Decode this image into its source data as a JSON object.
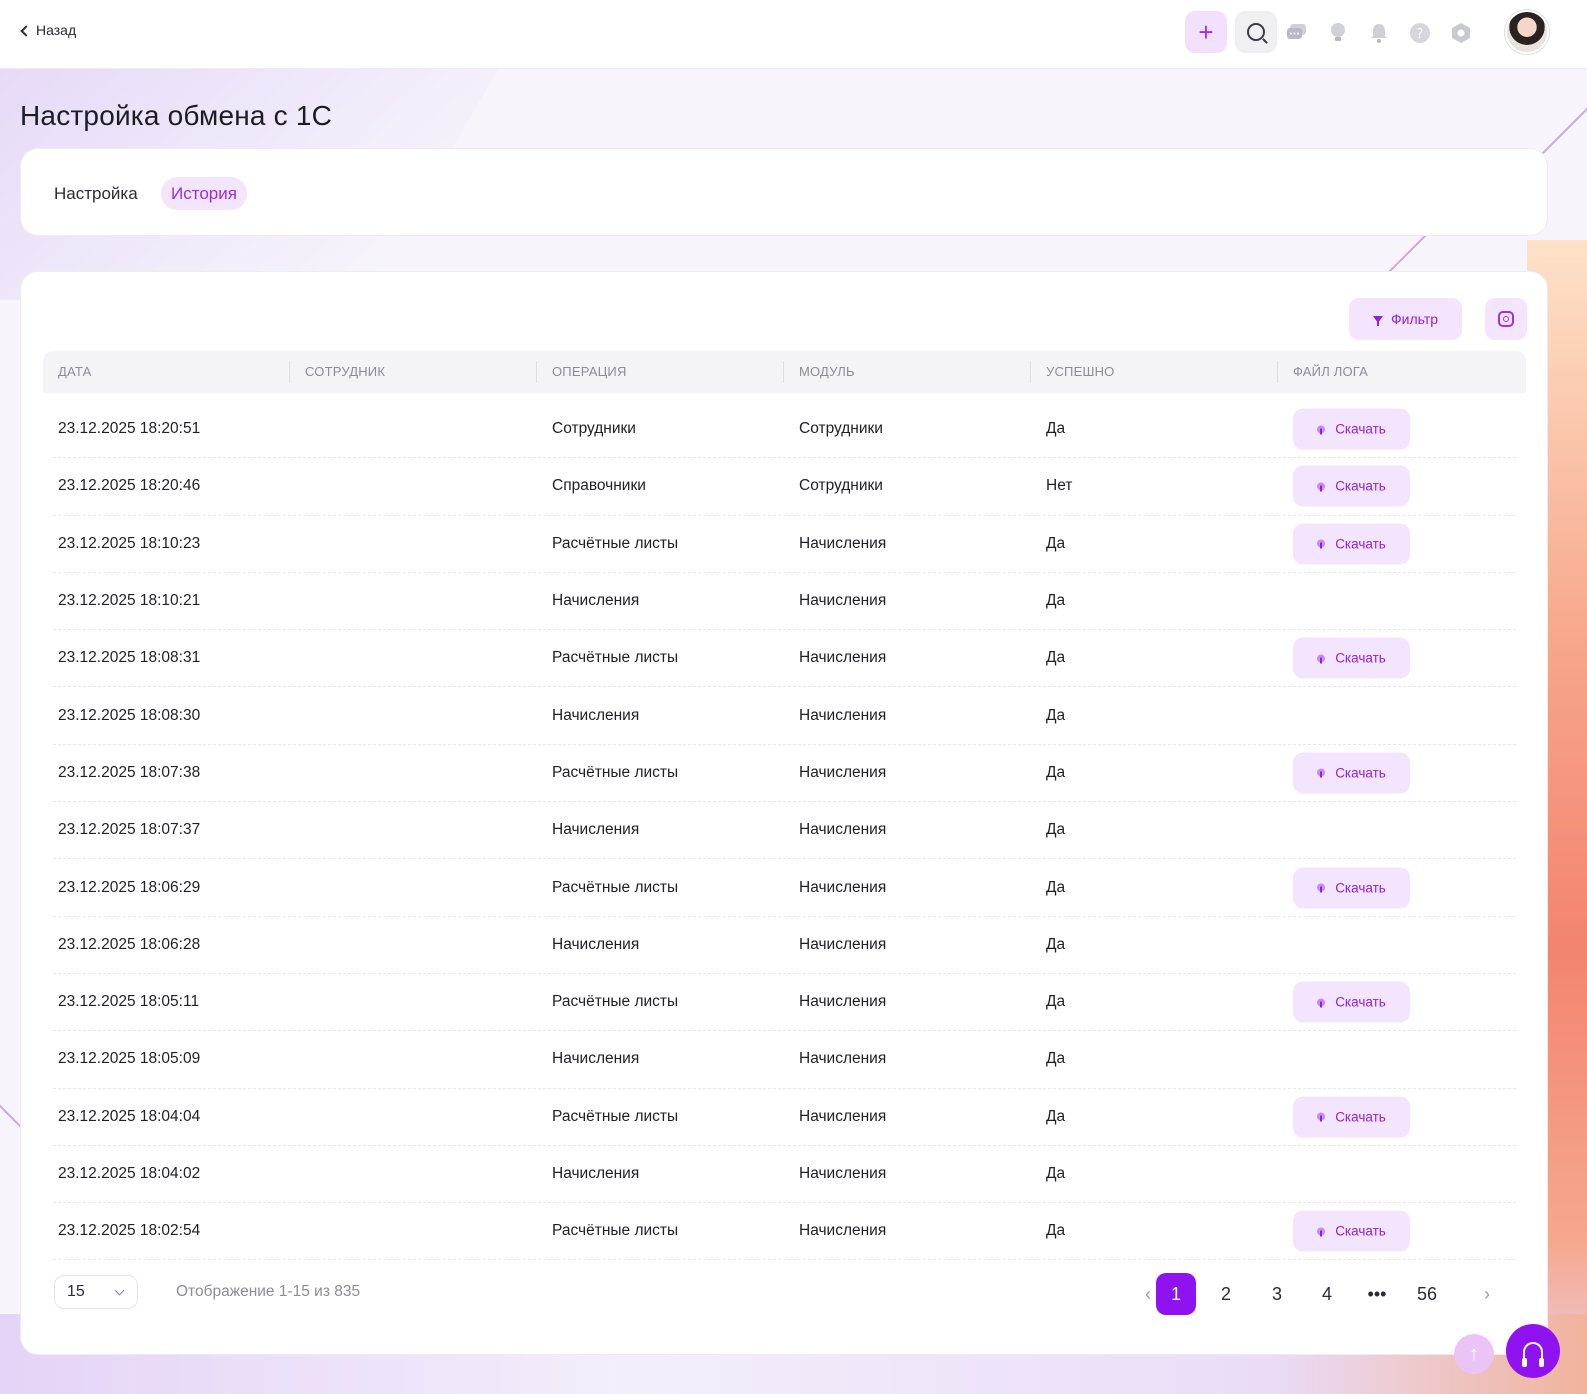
{
  "nav": {
    "back_label": "Назад"
  },
  "header": {
    "icons": [
      "plus-icon",
      "search-icon",
      "chat-icon",
      "lightbulb-icon",
      "bell-icon",
      "help-icon",
      "settings-icon"
    ]
  },
  "page": {
    "title": "Настройка обмена с 1С"
  },
  "tabs": [
    {
      "label": "Настройка",
      "active": false
    },
    {
      "label": "История",
      "active": true
    }
  ],
  "toolbar": {
    "filter_label": "Фильтр"
  },
  "table": {
    "columns": [
      "ДАТА",
      "СОТРУДНИК",
      "ОПЕРАЦИЯ",
      "МОДУЛЬ",
      "УСПЕШНО",
      "ФАЙЛ ЛОГА"
    ],
    "download_label": "Скачать",
    "rows": [
      {
        "date": "23.12.2025 18:20:51",
        "employee": "",
        "operation": "Сотрудники",
        "module": "Сотрудники",
        "success": "Да",
        "has_log": true
      },
      {
        "date": "23.12.2025 18:20:46",
        "employee": "",
        "operation": "Справочники",
        "module": "Сотрудники",
        "success": "Нет",
        "has_log": true
      },
      {
        "date": "23.12.2025 18:10:23",
        "employee": "",
        "operation": "Расчётные листы",
        "module": "Начисления",
        "success": "Да",
        "has_log": true
      },
      {
        "date": "23.12.2025 18:10:21",
        "employee": "",
        "operation": "Начисления",
        "module": "Начисления",
        "success": "Да",
        "has_log": false
      },
      {
        "date": "23.12.2025 18:08:31",
        "employee": "",
        "operation": "Расчётные листы",
        "module": "Начисления",
        "success": "Да",
        "has_log": true
      },
      {
        "date": "23.12.2025 18:08:30",
        "employee": "",
        "operation": "Начисления",
        "module": "Начисления",
        "success": "Да",
        "has_log": false
      },
      {
        "date": "23.12.2025 18:07:38",
        "employee": "",
        "operation": "Расчётные листы",
        "module": "Начисления",
        "success": "Да",
        "has_log": true
      },
      {
        "date": "23.12.2025 18:07:37",
        "employee": "",
        "operation": "Начисления",
        "module": "Начисления",
        "success": "Да",
        "has_log": false
      },
      {
        "date": "23.12.2025 18:06:29",
        "employee": "",
        "operation": "Расчётные листы",
        "module": "Начисления",
        "success": "Да",
        "has_log": true
      },
      {
        "date": "23.12.2025 18:06:28",
        "employee": "",
        "operation": "Начисления",
        "module": "Начисления",
        "success": "Да",
        "has_log": false
      },
      {
        "date": "23.12.2025 18:05:11",
        "employee": "",
        "operation": "Расчётные листы",
        "module": "Начисления",
        "success": "Да",
        "has_log": true
      },
      {
        "date": "23.12.2025 18:05:09",
        "employee": "",
        "operation": "Начисления",
        "module": "Начисления",
        "success": "Да",
        "has_log": false
      },
      {
        "date": "23.12.2025 18:04:04",
        "employee": "",
        "operation": "Расчётные листы",
        "module": "Начисления",
        "success": "Да",
        "has_log": true
      },
      {
        "date": "23.12.2025 18:04:02",
        "employee": "",
        "operation": "Начисления",
        "module": "Начисления",
        "success": "Да",
        "has_log": false
      },
      {
        "date": "23.12.2025 18:02:54",
        "employee": "",
        "operation": "Расчётные листы",
        "module": "Начисления",
        "success": "Да",
        "has_log": true
      }
    ]
  },
  "pagination": {
    "page_size": "15",
    "showing": "Отображение 1-15 из 835",
    "pages": [
      "1",
      "2",
      "3",
      "4",
      "•••",
      "56"
    ],
    "current": "1",
    "prev": "‹",
    "next": "›"
  },
  "colors": {
    "accent": "#8f13f0",
    "accent_soft": "#f3e5fd",
    "text": "#1f1f24",
    "muted": "#8c8c97"
  }
}
